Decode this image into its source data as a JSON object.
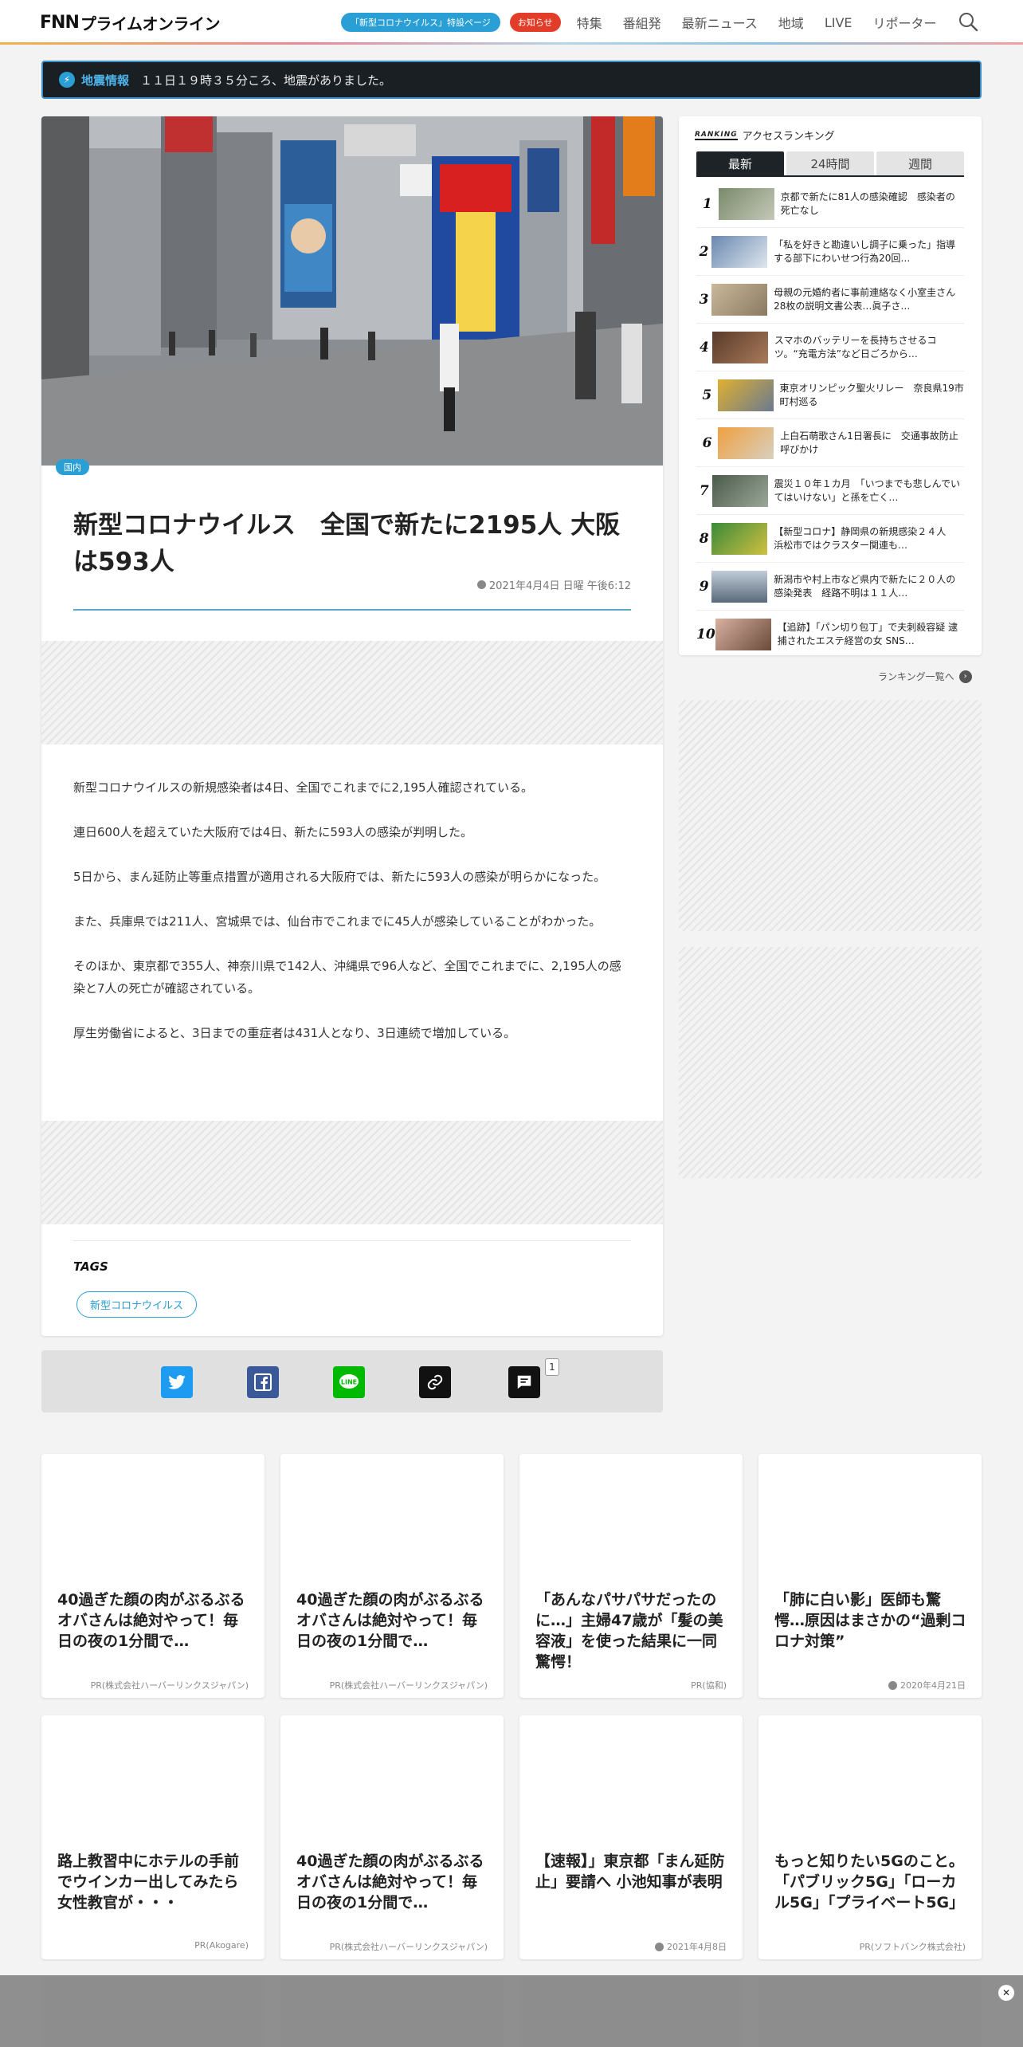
{
  "header": {
    "logo_fnn": "FNN",
    "logo_text": "プライムオンライン",
    "special_pill": "「新型コロナウイルス」特設ページ",
    "notice_pill": "お知らせ",
    "nav": [
      "特集",
      "番組発",
      "最新ニュース",
      "地域",
      "LIVE",
      "リポーター"
    ]
  },
  "alert": {
    "label": "地震情報",
    "text": "１１日１９時３５分ころ、地震がありました。"
  },
  "article": {
    "category": "国内",
    "title": "新型コロナウイルス　全国で新たに2195人 大阪は593人",
    "date": "2021年4月4日 日曜 午後6:12",
    "paragraphs": [
      "新型コロナウイルスの新規感染者は4日、全国でこれまでに2,195人確認されている。",
      "連日600人を超えていた大阪府では4日、新たに593人の感染が判明した。",
      "5日から、まん延防止等重点措置が適用される大阪府では、新たに593人の感染が明らかになった。",
      "また、兵庫県では211人、宮城県では、仙台市でこれまでに45人が感染していることがわかった。",
      "そのほか、東京都で355人、神奈川県で142人、沖縄県で96人など、全国でこれまでに、2,195人の感染と7人の死亡が確認されている。",
      "厚生労働省によると、3日までの重症者は431人となり、3日連続で増加している。"
    ],
    "tags_heading": "TAGS",
    "tags": [
      "新型コロナウイルス"
    ]
  },
  "share": {
    "comment_count": "1"
  },
  "ranking": {
    "logo": "RANKING",
    "title": "アクセスランキング",
    "tabs": [
      "最新",
      "24時間",
      "週間"
    ],
    "items": [
      {
        "num": "1",
        "text": "京都で新たに81人の感染確認　感染者の死亡なし"
      },
      {
        "num": "2",
        "text": "「私を好きと勘違いし調子に乗った」指導する部下にわいせつ行為20回…"
      },
      {
        "num": "3",
        "text": "母親の元婚約者に事前連絡なく小室圭さん28枚の説明文書公表…眞子さ…"
      },
      {
        "num": "4",
        "text": "スマホのバッテリーを長持ちさせるコツ。“充電方法”など日ごろから…"
      },
      {
        "num": "5",
        "text": "東京オリンピック聖火リレー　奈良県19市町村巡る"
      },
      {
        "num": "6",
        "text": "上白石萌歌さん1日署長に　交通事故防止呼びかけ"
      },
      {
        "num": "7",
        "text": "震災１０年１カ月　「いつまでも悲しんでいてはいけない」と孫を亡く…"
      },
      {
        "num": "8",
        "text": "【新型コロナ】静岡県の新規感染２４人　浜松市ではクラスター関連も…"
      },
      {
        "num": "9",
        "text": "新潟市や村上市など県内で新たに２０人の感染発表　経路不明は１１人…"
      },
      {
        "num": "10",
        "text": "【追跡】「パン切り包丁」で夫刺殺容疑 逮捕されたエステ経営の女 SNS…"
      }
    ],
    "more": "ランキング一覧へ"
  },
  "recommend": [
    {
      "title": "40過ぎた顔の肉がぶるぶるオバさんは絶対やって！毎日の夜の1分間で…",
      "meta": "PR(株式会社ハーバーリンクスジャパン)"
    },
    {
      "title": "40過ぎた顔の肉がぶるぶるオバさんは絶対やって！毎日の夜の1分間で…",
      "meta": "PR(株式会社ハーバーリンクスジャパン)"
    },
    {
      "title": "「あんなパサパサだったのに…」主婦47歳が「髪の美容液」を使った結果に一同驚愕！",
      "meta": "PR(協和)"
    },
    {
      "title": "「肺に白い影」医師も驚愕…原因はまさかの“過剰コロナ対策”",
      "meta": "2020年4月21日"
    },
    {
      "title": "路上教習中にホテルの手前でウインカー出してみたら女性教官が・・・",
      "meta": "PR(Akogare)"
    },
    {
      "title": "40過ぎた顔の肉がぶるぶるオバさんは絶対やって！毎日の夜の1分間で…",
      "meta": "PR(株式会社ハーバーリンクスジャパン)"
    },
    {
      "title": "【速報】」東京都「まん延防止」要請へ 小池知事が表明",
      "meta": "2021年4月8日"
    },
    {
      "title": "もっと知りたい5Gのこと。「パブリック5G」「ローカル5G」「プライベート5G」",
      "meta": "PR(ソフトバンク株式会社)"
    }
  ],
  "colors": {
    "accent": "#2a9fd6",
    "notice": "#e23d28",
    "dark": "#1d2327"
  }
}
